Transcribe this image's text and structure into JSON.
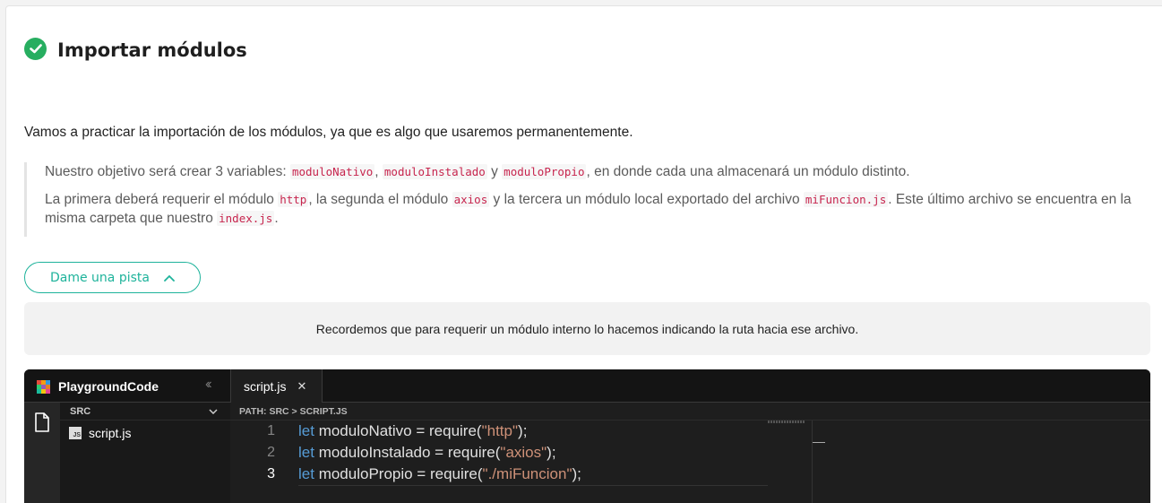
{
  "page": {
    "title": "Importar módulos",
    "intro": "Vamos a practicar la importación de los módulos, ya que es algo que usaremos permanentemente.",
    "quote": {
      "p1": {
        "t1": "Nuestro objetivo será crear 3 variables: ",
        "c1": "moduloNativo",
        "t2": ", ",
        "c2": "moduloInstalado",
        "t3": " y ",
        "c3": "moduloPropio",
        "t4": ", en donde cada una almacenará un módulo distinto."
      },
      "p2": {
        "t1": "La primera deberá requerir el módulo ",
        "c1": "http",
        "t2": ", la segunda el módulo ",
        "c2": "axios",
        "t3": " y la tercera un módulo local exportado del archivo ",
        "c3": "miFuncion.js",
        "t4": ". Este último archivo se encuentra en la misma carpeta que nuestro ",
        "c4": "index.js",
        "t5": "."
      }
    },
    "hint_button": "Dame una pista",
    "hint_text": "Recordemos que para requerir un módulo interno lo hacemos indicando la ruta hacia ese archivo."
  },
  "ide": {
    "brand": "PlaygroundCode",
    "tab_label": "script.js",
    "folder": "SRC",
    "file": "script.js",
    "path": "PATH: SRC > SCRIPT.JS",
    "lines": [
      {
        "num": "1",
        "kw": "let",
        "name": " moduloNativo = require(",
        "str": "\"http\"",
        "end": ");"
      },
      {
        "num": "2",
        "kw": "let",
        "name": " moduloInstalado = require(",
        "str": "\"axios\"",
        "end": ");"
      },
      {
        "num": "3",
        "kw": "let",
        "name": " moduloPropio = require(",
        "str": "\"./miFuncion\"",
        "end": ");"
      }
    ]
  },
  "colors": {
    "accent": "#1eb39b",
    "success": "#27ae60",
    "code_highlight": "#c7254e",
    "keyword": "#569cd6",
    "string": "#ce9178"
  },
  "icons": [
    "check-circle-icon",
    "chevron-up-icon",
    "playground-logo-icon",
    "collapse-left-icon",
    "close-icon",
    "file-icon",
    "chevron-down-icon",
    "js-file-icon"
  ]
}
